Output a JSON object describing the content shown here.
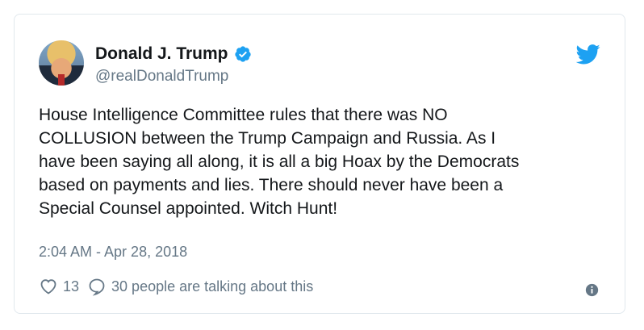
{
  "author": {
    "name": "Donald J. Trump",
    "handle": "@realDonaldTrump",
    "verified": true
  },
  "tweet": {
    "text": "House Intelligence Committee rules that there was NO\nCOLLUSION between the Trump Campaign and Russia. As I\nhave been saying all along, it is all a big Hoax by the Democrats\nbased on payments and lies. There should never have been a\nSpecial Counsel appointed. Witch Hunt!",
    "timestamp": "2:04 AM - Apr 28, 2018"
  },
  "actions": {
    "likes": "13",
    "talking": "30 people are talking about this"
  },
  "colors": {
    "brand_blue": "#1da1f2",
    "secondary_text": "#657786",
    "border": "#e1e8ed"
  },
  "icons": [
    "verified-icon",
    "twitter-bird-icon",
    "heart-icon",
    "reply-bubble-icon",
    "info-icon"
  ]
}
